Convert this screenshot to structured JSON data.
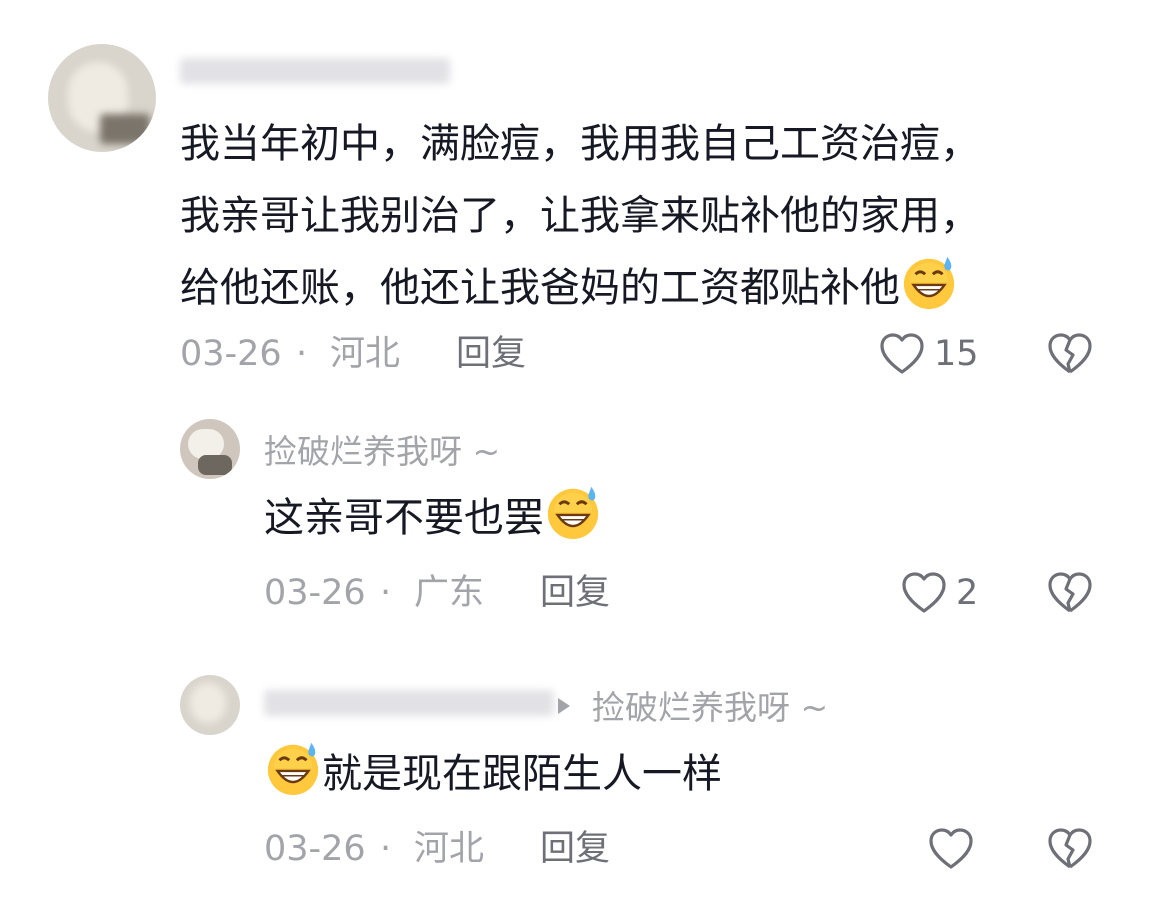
{
  "comment": {
    "lines": [
      "我当年初中，满脸痘，我用我自己工资治痘，",
      "我亲哥让我别治了，让我拿来贴补他的家用，",
      "给他还账，他还让我爸妈的工资都贴补他"
    ],
    "date": "03-26",
    "region": "河北",
    "reply_label": "回复",
    "likes": "15"
  },
  "reply1": {
    "username": "捡破烂养我呀 ~",
    "text": "这亲哥不要也罢",
    "date": "03-26",
    "region": "广东",
    "reply_label": "回复",
    "likes": "2"
  },
  "reply2": {
    "reply_to": "捡破烂养我呀 ~",
    "text": "就是现在跟陌生人一样",
    "date": "03-26",
    "region": "河北",
    "reply_label": "回复"
  },
  "separator": "·",
  "icons": {
    "like": "heart-outline-icon",
    "dislike": "broken-heart-icon",
    "emoji": "grinning-sweat-emoji",
    "reply_arrow": "triangle-right-icon"
  },
  "colors": {
    "text": "#161823",
    "meta": "#a3a4aa",
    "secondary": "#6e6f77"
  }
}
